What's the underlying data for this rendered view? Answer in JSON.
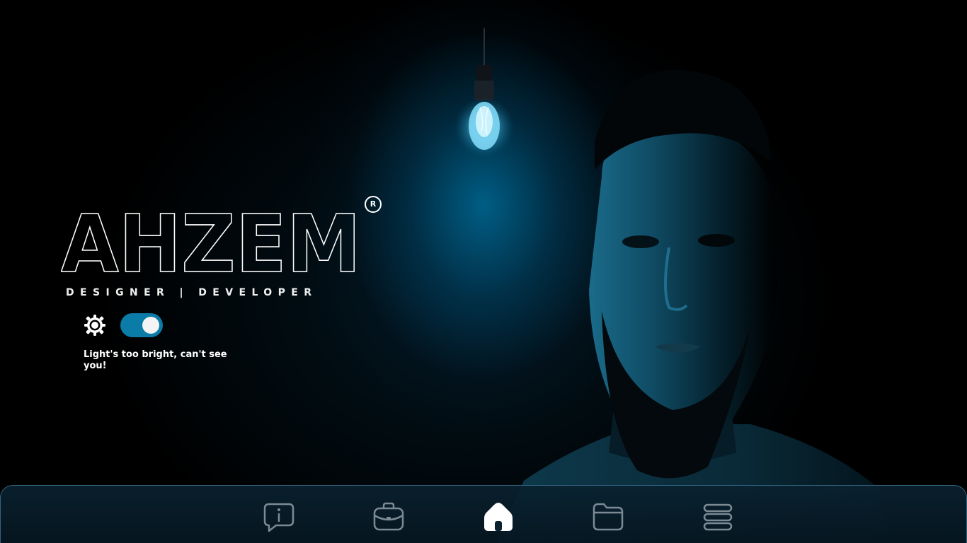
{
  "brand": {
    "name": "AHZEM",
    "registered_mark": "R",
    "tagline": "DESIGNER | DEVELOPER"
  },
  "theme_switch": {
    "icon": "sun-icon",
    "state": "on",
    "hint": "Light's too bright, can't see you!"
  },
  "dock": {
    "items": [
      {
        "name": "about",
        "icon": "info-bubble-icon",
        "active": false
      },
      {
        "name": "work",
        "icon": "briefcase-icon",
        "active": false
      },
      {
        "name": "home",
        "icon": "home-icon",
        "active": true
      },
      {
        "name": "projects",
        "icon": "folder-icon",
        "active": false
      },
      {
        "name": "stack",
        "icon": "layers-icon",
        "active": false
      }
    ]
  },
  "colors": {
    "background": "#000000",
    "glow": "#0a7fb0",
    "toggle_on": "#0b7ba8",
    "icon_inactive": "#7c8a94",
    "icon_active": "#ffffff"
  }
}
